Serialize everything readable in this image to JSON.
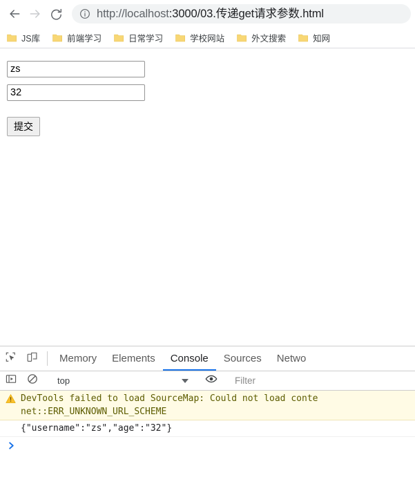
{
  "browser": {
    "nav": {
      "back_icon": "arrow-left-icon",
      "forward_icon": "arrow-right-icon",
      "reload_icon": "reload-icon"
    },
    "omnibox": {
      "site_info_icon": "info-circle-icon",
      "url_scheme": "http://localhost",
      "url_rest": ":3000/03.传递get请求参数.html",
      "url_full": "http://localhost:3000/03.传递get请求参数.html"
    },
    "bookmarks": [
      {
        "label": "JS库",
        "icon": "folder-icon"
      },
      {
        "label": "前端学习",
        "icon": "folder-icon"
      },
      {
        "label": "日常学习",
        "icon": "folder-icon"
      },
      {
        "label": "学校网站",
        "icon": "folder-icon"
      },
      {
        "label": "外文搜索",
        "icon": "folder-icon"
      },
      {
        "label": "知网",
        "icon": "folder-icon"
      }
    ]
  },
  "page": {
    "username_value": "zs",
    "age_value": "32",
    "submit_label": "提交"
  },
  "devtools": {
    "inspect_icon": "inspect-element-icon",
    "device_icon": "device-toolbar-icon",
    "tabs": [
      {
        "label": "Memory",
        "active": false
      },
      {
        "label": "Elements",
        "active": false
      },
      {
        "label": "Console",
        "active": true
      },
      {
        "label": "Sources",
        "active": false
      },
      {
        "label": "Netwo",
        "active": false
      }
    ],
    "console_toolbar": {
      "sidebar_icon": "console-sidebar-icon",
      "clear_icon": "clear-console-icon",
      "context_value": "top",
      "caret_icon": "chevron-down-icon",
      "eye_icon": "eye-icon",
      "filter_placeholder": "Filter",
      "filter_value": ""
    },
    "messages": [
      {
        "level": "warning",
        "icon": "warning-triangle-icon",
        "line1": "DevTools failed to load SourceMap: Could not load conte",
        "line2": "net::ERR_UNKNOWN_URL_SCHEME"
      },
      {
        "level": "log",
        "text": "{\"username\":\"zs\",\"age\":\"32\"}"
      }
    ],
    "prompt_icon": "prompt-chevron-icon"
  },
  "colors": {
    "accent_blue": "#1a73e8",
    "warning_bg": "#fffbe5",
    "warning_text": "#5c5c00",
    "folder_yellow": "#f7d66a",
    "omnibox_bg": "#f1f3f4"
  }
}
